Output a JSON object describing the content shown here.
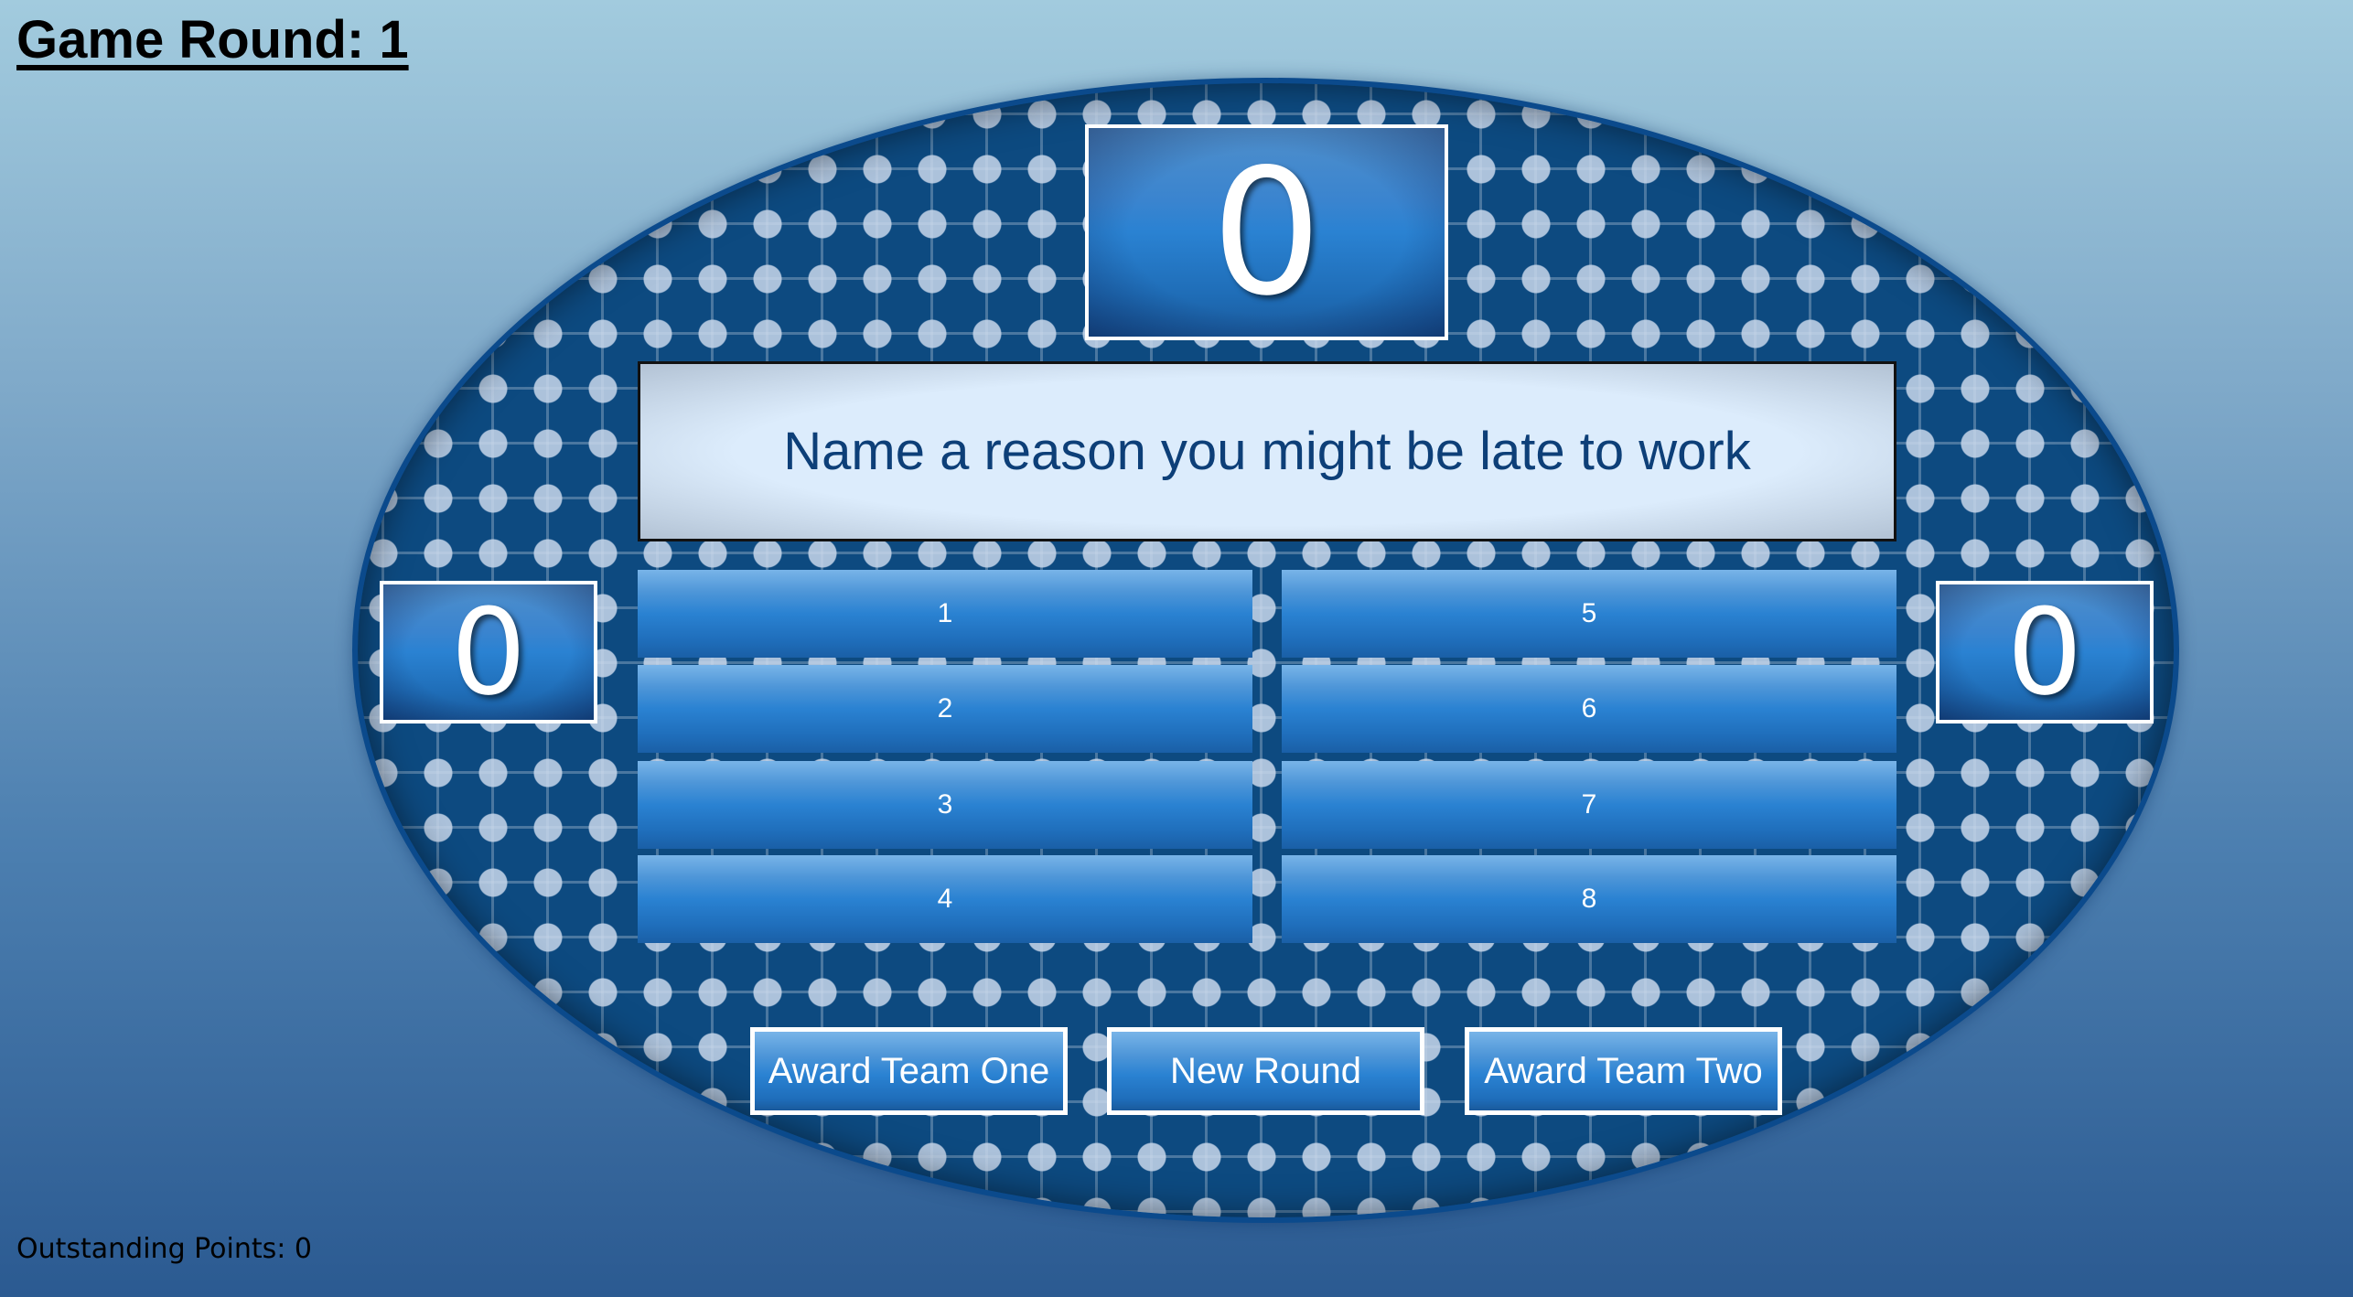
{
  "header": {
    "round_label": "Game Round: 1"
  },
  "board": {
    "round_score": "0",
    "team_one_score": "0",
    "team_two_score": "0",
    "question": "Name a reason you might be late to work",
    "answers": [
      {
        "label": "1"
      },
      {
        "label": "2"
      },
      {
        "label": "3"
      },
      {
        "label": "4"
      },
      {
        "label": "5"
      },
      {
        "label": "6"
      },
      {
        "label": "7"
      },
      {
        "label": "8"
      }
    ]
  },
  "controls": {
    "award_team_one": "Award Team One",
    "new_round": "New Round",
    "award_team_two": "Award Team Two"
  },
  "footer": {
    "outstanding_points": "Outstanding Points: 0"
  },
  "colors": {
    "board_blue": "#0d4a80",
    "tile_blue": "#2a82d2",
    "question_text": "#0d3f78",
    "question_bg": "#dcecfc"
  }
}
